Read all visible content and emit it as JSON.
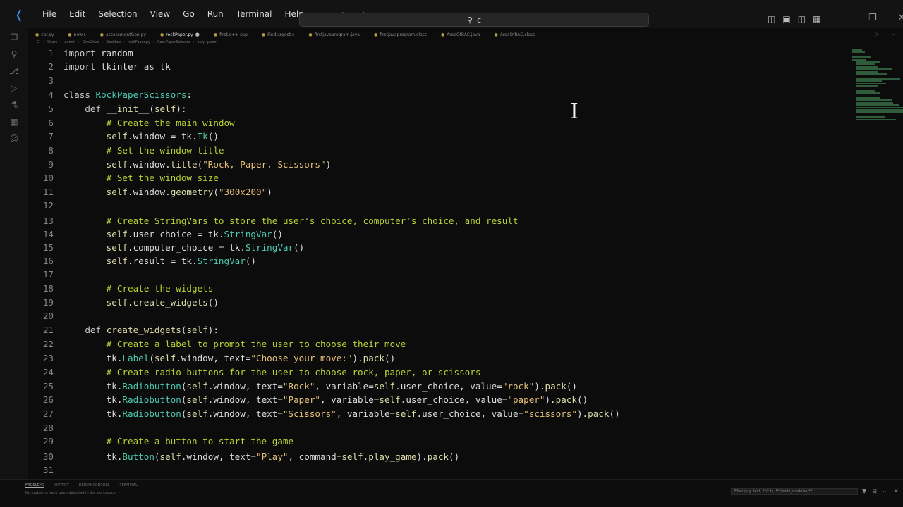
{
  "menu": [
    "File",
    "Edit",
    "Selection",
    "View",
    "Go",
    "Run",
    "Terminal",
    "Help"
  ],
  "command_center": {
    "text": "c"
  },
  "tabs": [
    {
      "label": "car.py"
    },
    {
      "label": "new.c"
    },
    {
      "label": "assessmentGen.py"
    },
    {
      "label": "rockPaper.py",
      "active": true
    },
    {
      "label": "first.c++ cpp"
    },
    {
      "label": "Findlargest.c"
    },
    {
      "label": "firstjavaprogram.java"
    },
    {
      "label": "firstjavaprogram.class"
    },
    {
      "label": "AreaOfRAC.java"
    },
    {
      "label": "AreaOfRAC.class"
    }
  ],
  "breadcrumb": [
    "C:",
    "Users",
    "admin",
    "OneDrive",
    "Desktop",
    "rockPaper.py",
    "RockPaperScissors",
    "play_game"
  ],
  "code": [
    {
      "n": "1",
      "t": [
        [
          "kw",
          "import "
        ],
        [
          "d",
          "random"
        ]
      ]
    },
    {
      "n": "2",
      "t": [
        [
          "kw",
          "import "
        ],
        [
          "d",
          "tkinter "
        ],
        [
          "kw",
          "as "
        ],
        [
          "d",
          "tk"
        ]
      ]
    },
    {
      "n": "3",
      "t": []
    },
    {
      "n": "4",
      "t": [
        [
          "kw",
          "class "
        ],
        [
          "cls",
          "RockPaperScissors"
        ],
        [
          "d",
          ":"
        ]
      ]
    },
    {
      "n": "5",
      "t": [
        [
          "d",
          "    "
        ],
        [
          "kw",
          "def "
        ],
        [
          "fn",
          "__init__"
        ],
        [
          "d",
          "("
        ],
        [
          "self",
          "self"
        ],
        [
          "d",
          "):"
        ]
      ]
    },
    {
      "n": "6",
      "t": [
        [
          "d",
          "        "
        ],
        [
          "cmt",
          "# Create the main window"
        ]
      ]
    },
    {
      "n": "7",
      "t": [
        [
          "d",
          "        "
        ],
        [
          "self",
          "self"
        ],
        [
          "d",
          ".window = tk."
        ],
        [
          "cls",
          "Tk"
        ],
        [
          "d",
          "()"
        ]
      ]
    },
    {
      "n": "8",
      "t": [
        [
          "d",
          "        "
        ],
        [
          "cmt",
          "# Set the window title"
        ]
      ]
    },
    {
      "n": "9",
      "t": [
        [
          "d",
          "        "
        ],
        [
          "self",
          "self"
        ],
        [
          "d",
          ".window."
        ],
        [
          "fn",
          "title"
        ],
        [
          "d",
          "("
        ],
        [
          "str",
          "\"Rock, Paper, Scissors\""
        ],
        [
          "d",
          ")"
        ]
      ]
    },
    {
      "n": "10",
      "t": [
        [
          "d",
          "        "
        ],
        [
          "cmt",
          "# Set the window size"
        ]
      ]
    },
    {
      "n": "11",
      "t": [
        [
          "d",
          "        "
        ],
        [
          "self",
          "self"
        ],
        [
          "d",
          ".window."
        ],
        [
          "fn",
          "geometry"
        ],
        [
          "d",
          "("
        ],
        [
          "str",
          "\"300x200\""
        ],
        [
          "d",
          ")"
        ]
      ]
    },
    {
      "n": "12",
      "t": []
    },
    {
      "n": "13",
      "t": [
        [
          "d",
          "        "
        ],
        [
          "cmt",
          "# Create StringVars to store the user's choice, computer's choice, and result"
        ]
      ]
    },
    {
      "n": "14",
      "t": [
        [
          "d",
          "        "
        ],
        [
          "self",
          "self"
        ],
        [
          "d",
          ".user_choice = tk."
        ],
        [
          "cls",
          "StringVar"
        ],
        [
          "d",
          "()"
        ]
      ]
    },
    {
      "n": "15",
      "t": [
        [
          "d",
          "        "
        ],
        [
          "self",
          "self"
        ],
        [
          "d",
          ".computer_choice = tk."
        ],
        [
          "cls",
          "StringVar"
        ],
        [
          "d",
          "()"
        ]
      ]
    },
    {
      "n": "16",
      "t": [
        [
          "d",
          "        "
        ],
        [
          "self",
          "self"
        ],
        [
          "d",
          ".result = tk."
        ],
        [
          "cls",
          "StringVar"
        ],
        [
          "d",
          "()"
        ]
      ]
    },
    {
      "n": "17",
      "t": []
    },
    {
      "n": "18",
      "t": [
        [
          "d",
          "        "
        ],
        [
          "cmt",
          "# Create the widgets"
        ]
      ]
    },
    {
      "n": "19",
      "t": [
        [
          "d",
          "        "
        ],
        [
          "self",
          "self"
        ],
        [
          "d",
          "."
        ],
        [
          "fn",
          "create_widgets"
        ],
        [
          "d",
          "()"
        ]
      ]
    },
    {
      "n": "20",
      "t": []
    },
    {
      "n": "21",
      "t": [
        [
          "d",
          "    "
        ],
        [
          "kw",
          "def "
        ],
        [
          "fn",
          "create_widgets"
        ],
        [
          "d",
          "("
        ],
        [
          "self",
          "self"
        ],
        [
          "d",
          "):"
        ]
      ]
    },
    {
      "n": "22",
      "t": [
        [
          "d",
          "        "
        ],
        [
          "cmt",
          "# Create a label to prompt the user to choose their move"
        ]
      ]
    },
    {
      "n": "23",
      "t": [
        [
          "d",
          "        tk."
        ],
        [
          "cls",
          "Label"
        ],
        [
          "d",
          "("
        ],
        [
          "self",
          "self"
        ],
        [
          "d",
          ".window, text="
        ],
        [
          "str",
          "\"Choose your move:\""
        ],
        [
          "d",
          ")."
        ],
        [
          "fn",
          "pack"
        ],
        [
          "d",
          "()"
        ]
      ]
    },
    {
      "n": "24",
      "t": [
        [
          "d",
          "        "
        ],
        [
          "cmt",
          "# Create radio buttons for the user to choose rock, paper, or scissors"
        ]
      ]
    },
    {
      "n": "25",
      "t": [
        [
          "d",
          "        tk."
        ],
        [
          "cls",
          "Radiobutton"
        ],
        [
          "d",
          "("
        ],
        [
          "self",
          "self"
        ],
        [
          "d",
          ".window, text="
        ],
        [
          "str",
          "\"Rock\""
        ],
        [
          "d",
          ", variable="
        ],
        [
          "self",
          "self"
        ],
        [
          "d",
          ".user_choice, value="
        ],
        [
          "str",
          "\"rock\""
        ],
        [
          "d",
          ")."
        ],
        [
          "fn",
          "pack"
        ],
        [
          "d",
          "()"
        ]
      ]
    },
    {
      "n": "26",
      "t": [
        [
          "d",
          "        tk."
        ],
        [
          "cls",
          "Radiobutton"
        ],
        [
          "d",
          "("
        ],
        [
          "self",
          "self"
        ],
        [
          "d",
          ".window, text="
        ],
        [
          "str",
          "\"Paper\""
        ],
        [
          "d",
          ", variable="
        ],
        [
          "self",
          "self"
        ],
        [
          "d",
          ".user_choice, value="
        ],
        [
          "str",
          "\"paper\""
        ],
        [
          "d",
          ")."
        ],
        [
          "fn",
          "pack"
        ],
        [
          "d",
          "()"
        ]
      ]
    },
    {
      "n": "27",
      "t": [
        [
          "d",
          "        tk."
        ],
        [
          "cls",
          "Radiobutton"
        ],
        [
          "d",
          "("
        ],
        [
          "self",
          "self"
        ],
        [
          "d",
          ".window, text="
        ],
        [
          "str",
          "\"Scissors\""
        ],
        [
          "d",
          ", variable="
        ],
        [
          "self",
          "self"
        ],
        [
          "d",
          ".user_choice, value="
        ],
        [
          "str",
          "\"scissors\""
        ],
        [
          "d",
          ")."
        ],
        [
          "fn",
          "pack"
        ],
        [
          "d",
          "()"
        ]
      ]
    },
    {
      "n": "28",
      "t": []
    },
    {
      "n": "29",
      "t": [
        [
          "d",
          "        "
        ],
        [
          "cmt",
          "# Create a button to start the game"
        ]
      ]
    },
    {
      "n": "30",
      "t": [
        [
          "d",
          "        tk."
        ],
        [
          "cls",
          "Button"
        ],
        [
          "d",
          "("
        ],
        [
          "self",
          "self"
        ],
        [
          "d",
          ".window, text="
        ],
        [
          "str",
          "\"Play\""
        ],
        [
          "d",
          ", command="
        ],
        [
          "self",
          "self"
        ],
        [
          "d",
          "."
        ],
        [
          "fn",
          "play_game"
        ],
        [
          "d",
          ")."
        ],
        [
          "fn",
          "pack"
        ],
        [
          "d",
          "()"
        ]
      ]
    },
    {
      "n": "31",
      "t": []
    }
  ],
  "panel": {
    "tabs": [
      "Problems",
      "Output",
      "Debug Console",
      "Terminal"
    ],
    "message": "No problems have been detected in the workspace.",
    "filter_placeholder": "Filter (e.g. text, **/*.ts, !**/node_modules/**)"
  }
}
